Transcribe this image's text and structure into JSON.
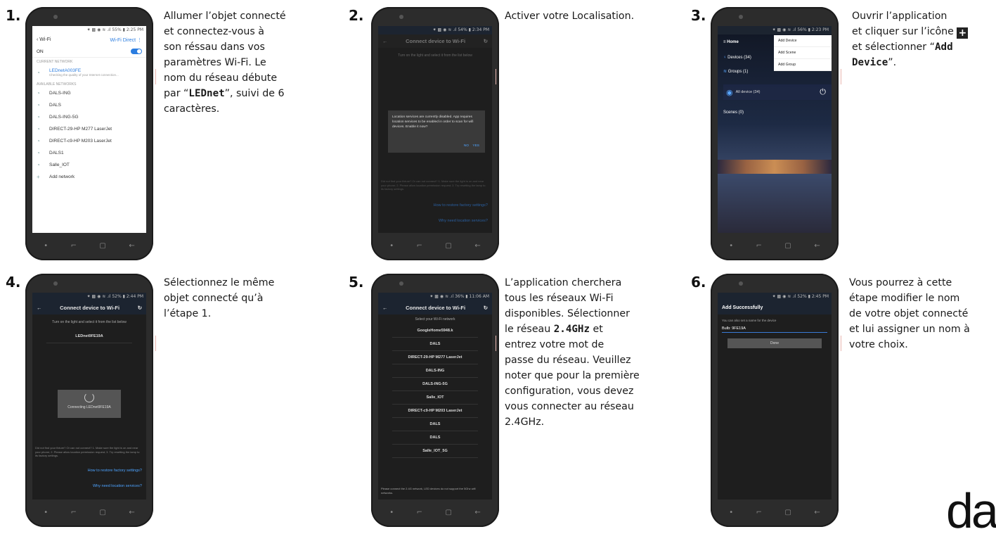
{
  "steps": [
    {
      "num": "1.",
      "lines": [
        "Allumer l’objet connecté",
        "et connectez-vous à",
        "son réssau dans vos",
        "paramètres Wi-Fi. Le",
        "nom du réseau débute"
      ],
      "l6a": "par “",
      "l6b": "LEDnet",
      "l6c": "”, suivi de 6",
      "l7": "caractères."
    },
    {
      "num": "2.",
      "text": "Activer votre Localisation."
    },
    {
      "num": "3.",
      "l1": "Ouvrir l’application",
      "l2": "et cliquer sur l’icône",
      "l3a": "et sélectionner “",
      "l3b": "Add",
      "l4a": "Device",
      "l4b": "”."
    },
    {
      "num": "4.",
      "lines": [
        "Sélectionnez le même",
        "objet connecté qu’à",
        "l’étape 1."
      ]
    },
    {
      "num": "5.",
      "lines": [
        "L’application cherchera",
        "tous les réseaux Wi-Fi",
        "disponibles. Sélectionner"
      ],
      "l4a": "le réseau ",
      "l4b": "2.4GHz",
      "l4c": " et",
      "lines2": [
        "entrez votre mot de",
        "passe du réseau. Veuillez",
        "noter que pour la première",
        "configuration, vous devez",
        "vous connecter au réseau",
        "2.4GHz."
      ]
    },
    {
      "num": "6.",
      "lines": [
        "Vous pourrez à cette",
        "étape modifier le nom",
        "de votre objet connecté",
        "et lui assigner un nom à",
        "votre choix."
      ]
    }
  ],
  "plus_icon": "+",
  "logo": "dals",
  "screens": {
    "s1": {
      "status": "⁕ ▩ ◉ ≋ .ıl 55% ▮ 2:25 PM",
      "header_left": "‹  Wi-Fi",
      "header_right": "Wi-Fi Direct  ⋮",
      "on": "ON",
      "current_label": "CURRENT NETWORK",
      "current_name": "LEDnetA003FE",
      "current_sub": "Checking the quality of your Internet connection...",
      "available_label": "AVAILABLE NETWORKS",
      "networks": [
        "DALS-ING",
        "DALS",
        "DALS-ING-5G",
        "DIRECT-29-HP M277 LaserJet",
        "DIRECT-c9-HP M203 LaserJet",
        "DALS1",
        "Salle_IOT"
      ],
      "add": "Add network"
    },
    "s2": {
      "status": "⁕ ▩ ◉ ≋ .ıl 54% ▮ 2:34 PM",
      "title": "Connect device to Wi-Fi",
      "hint": "Turn on the light and select it from the list below",
      "dialog": "Location services are currently disabled. App requires location services to be enabled in order to scan for wifi devices. Enable it now?",
      "no": "NO",
      "yes": "YES",
      "small": "Did not find your fixture? Or can not connect? 1. Make sure the light is on and near your phone; 2. Please allow location permission request; 3. Try resetting the lamp to its factory settings.",
      "link1": "How to restore factory settings?",
      "link2": "Why need location services?"
    },
    "s3": {
      "status": "⁕ ▩ ◉ ≋ .ıl 56% ▮ 2:23 PM",
      "home": "≡   Home",
      "devices": "Devices (34)",
      "groups": "Groups (1)",
      "menu": [
        "Add Device",
        "Add Scene",
        "Add Group"
      ],
      "all": "All device (34)",
      "scenes": "Scenes (0)"
    },
    "s4": {
      "status": "⁕ ▩ ◉ ≋ .ıl 52% ▮ 2:44 PM",
      "title": "Connect device to Wi-Fi",
      "hint": "Turn on the light and select it from the list below",
      "net": "LEDnet9FE19A",
      "connecting": "Connecting LEDnet9FE19A",
      "small": "Did not find your fixture? Or can not connect? 1. Make sure the light is on and near your phone; 2. Please allow location permission request; 3. Try resetting the lamp to its factory settings.",
      "link1": "How to restore factory settings?",
      "link2": "Why need location services?"
    },
    "s5": {
      "status": "⁕ ▩ ◉ ≋ .ıl 36% ▮ 11:06 AM",
      "title": "Connect device to Wi-Fi",
      "select": "Select your Wi-Fi network",
      "networks": [
        "GoogleHome5948.k",
        "DALS",
        "DIRECT-29-HP M277 LaserJet",
        "DALS-ING",
        "DALS-ING-5G",
        "Salle_IOT",
        "DIRECT-c9-HP M203 LaserJet",
        "DALS",
        "DALS",
        "Salle_IOT_5G"
      ],
      "note": "Please connect the 2.4G network, LED devices do not support the 5Ghz wifi networks."
    },
    "s6": {
      "status": "⁕ ▩ ◉ ≋ .ıl 52% ▮ 2:45 PM",
      "title": "Add Successfully",
      "hint": "You can also set a name for the device",
      "value": "Bulb: 9FE19A",
      "done": "Done"
    }
  },
  "nav": [
    "•",
    "⌐",
    "▢",
    "←"
  ]
}
